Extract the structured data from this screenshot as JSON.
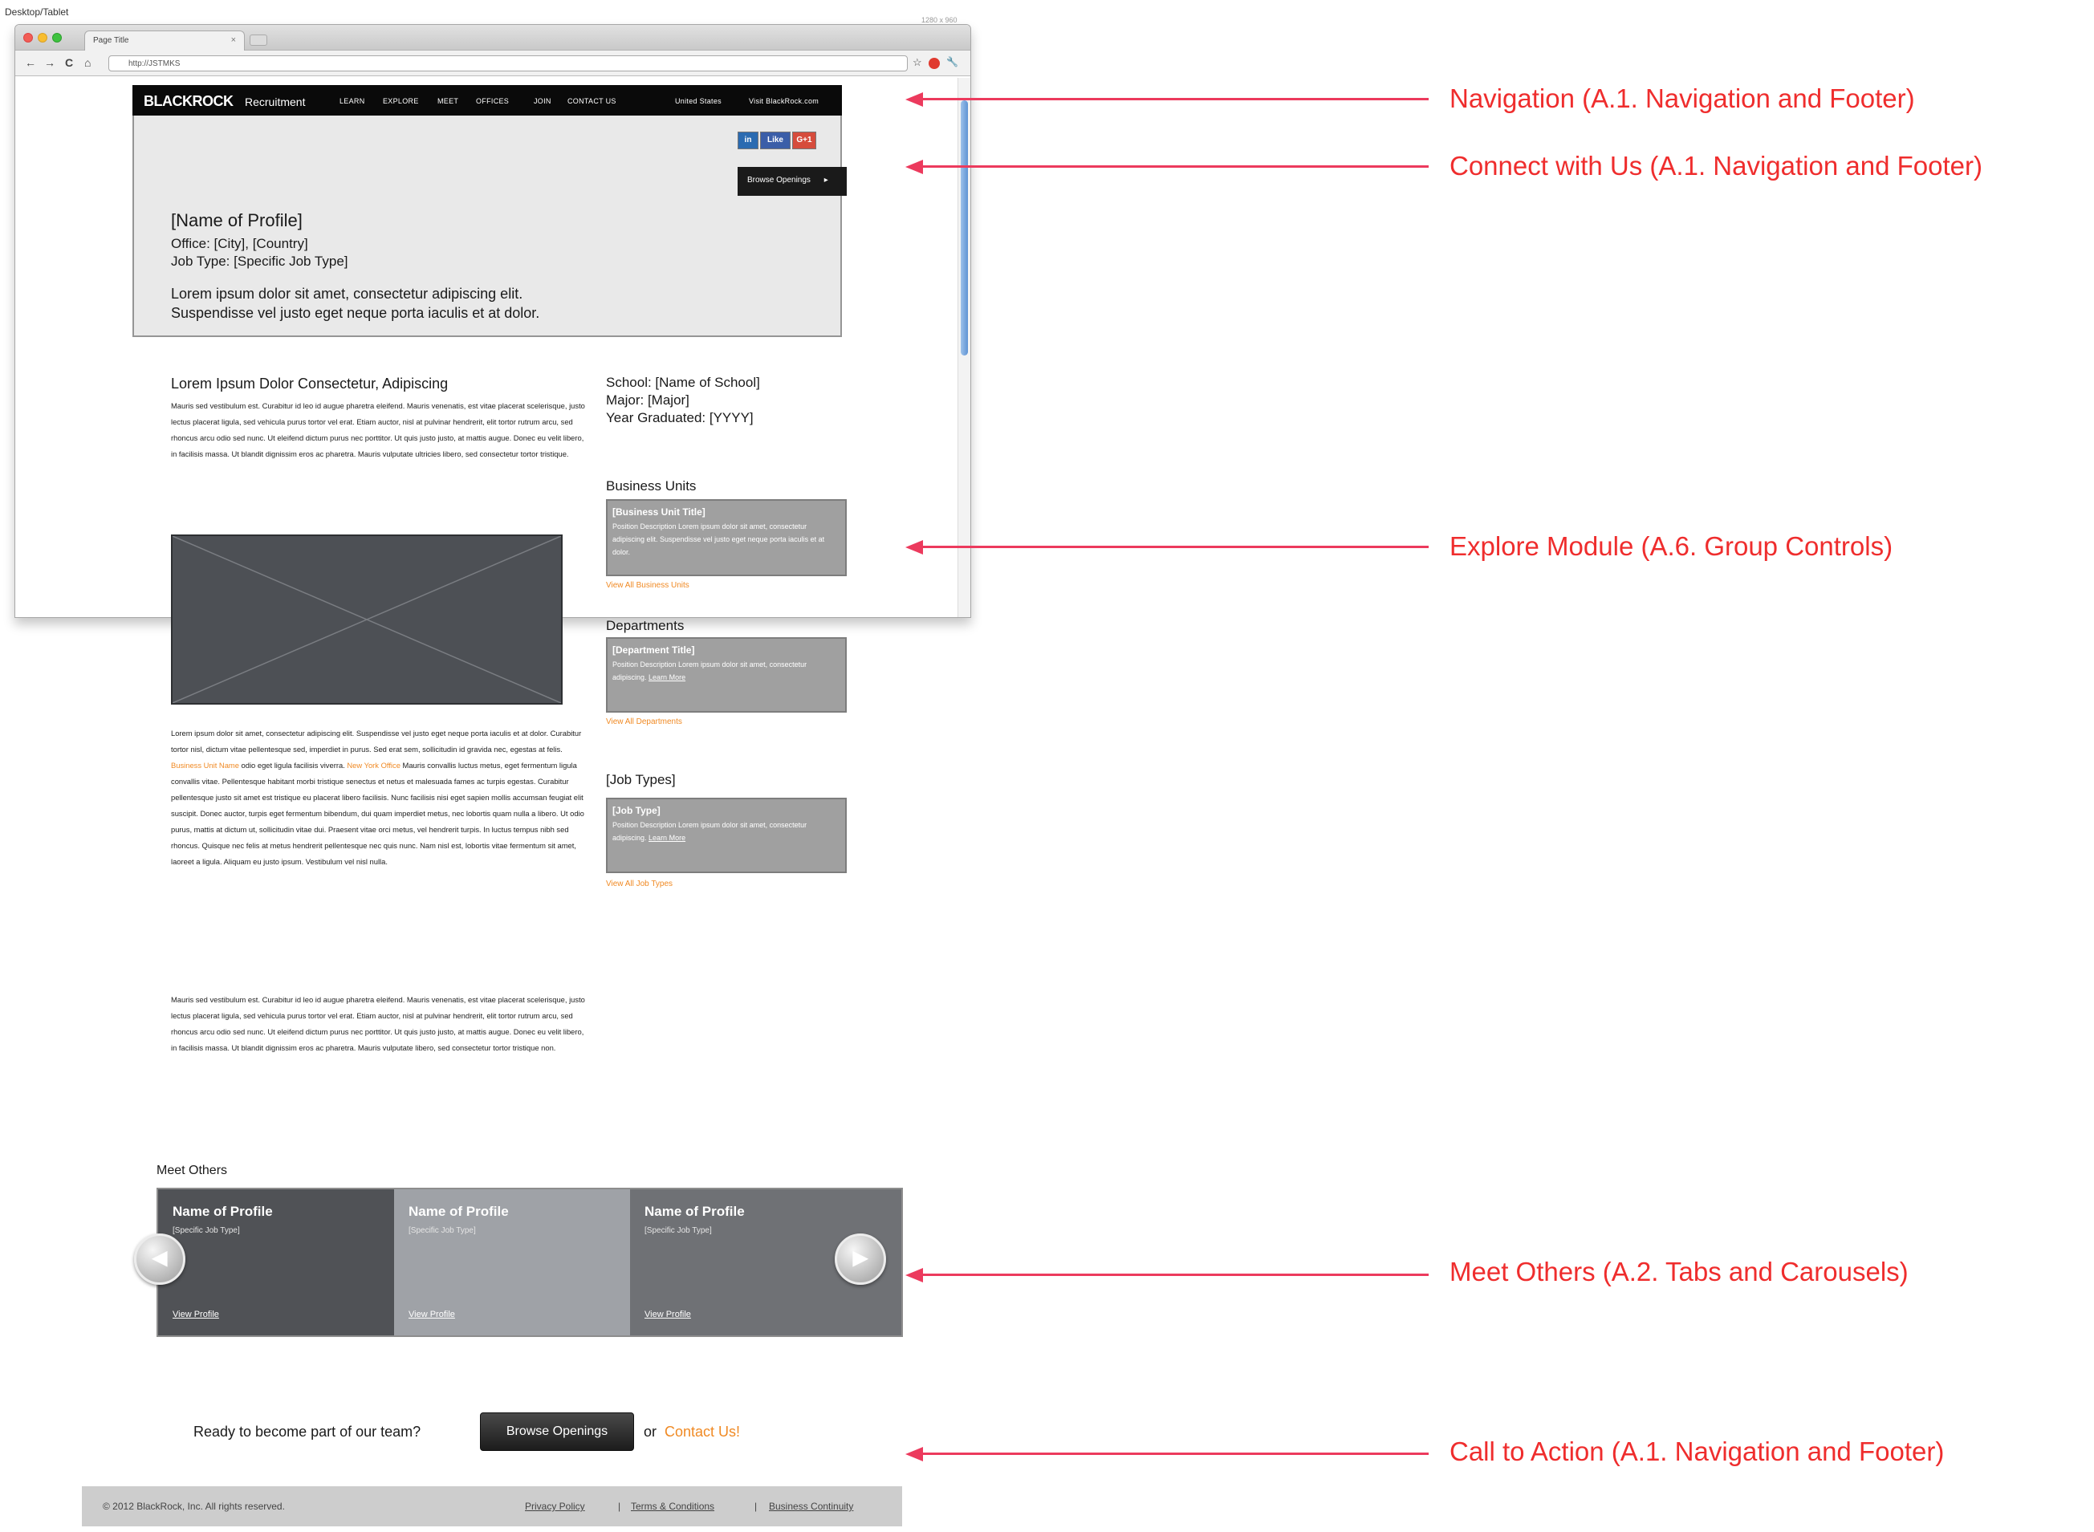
{
  "context": {
    "device_label": "Desktop/Tablet",
    "resolution_label": "1280 x 960"
  },
  "browser": {
    "tab_title": "Page Title",
    "tab_close": "×",
    "url": "http://JSTMKS",
    "nav_icons": {
      "back": "←",
      "forward": "→",
      "reload": "C",
      "home": "⌂"
    },
    "toolbar_icons": {
      "star": "☆",
      "wrench": "🔧"
    }
  },
  "site": {
    "nav": {
      "brand": "BLACKROCK",
      "brand_sub": "Recruitment",
      "items": [
        "LEARN",
        "EXPLORE",
        "MEET",
        "OFFICES",
        "JOIN",
        "CONTACT US"
      ],
      "region": "United States",
      "external_link": "Visit BlackRock.com"
    },
    "hero": {
      "social": [
        "in",
        "Like",
        "G+1"
      ],
      "browse_button": "Browse Openings",
      "browse_arrow": "▸",
      "name": "[Name of Profile]",
      "office": "Office: [City], [Country]",
      "job_type": "Job Type: [Specific Job Type]",
      "lorem_1": "Lorem ipsum dolor sit amet, consectetur adipiscing elit.",
      "lorem_2": "Suspendisse vel justo eget neque porta iaculis et at dolor."
    },
    "main": {
      "title": "Lorem Ipsum Dolor Consectetur, Adipiscing",
      "para1": "Mauris sed vestibulum est. Curabitur id leo id augue pharetra eleifend. Mauris venenatis, est vitae placerat scelerisque, justo lectus placerat ligula, sed vehicula purus tortor vel erat. Etiam auctor, nisl at pulvinar hendrerit, elit tortor rutrum arcu, sed rhoncus arcu odio sed nunc. Ut eleifend dictum purus nec porttitor. Ut quis justo justo, at mattis augue. Donec eu velit libero, in facilisis massa. Ut blandit dignissim eros ac pharetra. Mauris vulputate ultricies libero, sed consectetur tortor tristique.",
      "para2_a": "Lorem ipsum dolor sit amet, consectetur adipiscing elit. Suspendisse vel justo eget neque porta iaculis et at dolor. Curabitur tortor nisl, dictum vitae pellentesque sed, imperdiet in purus. Sed erat sem, sollicitudin id gravida nec, egestas at felis.",
      "para2_link1": "Business Unit Name",
      "para2_b": "odio eget ligula facilisis viverra.",
      "para2_link2": "New York Office",
      "para2_c": "Mauris convallis luctus metus, eget fermentum ligula convallis vitae. Pellentesque habitant morbi tristique senectus et netus et malesuada fames ac turpis egestas. Curabitur pellentesque justo sit amet est tristique eu placerat libero facilisis. Nunc facilisis nisi eget sapien mollis accumsan feugiat elit suscipit. Donec auctor, turpis eget fermentum bibendum, dui quam imperdiet metus, nec lobortis quam nulla a libero. Ut odio purus, mattis at dictum ut, sollicitudin vitae dui. Praesent vitae orci metus, vel hendrerit turpis. In luctus tempus nibh sed rhoncus. Quisque nec felis at metus hendrerit pellentesque nec quis nunc. Nam nisl est, lobortis vitae fermentum sit amet, laoreet a ligula. Aliquam eu justo ipsum. Vestibulum vel nisl nulla.",
      "para3": "Mauris sed vestibulum est. Curabitur id leo id augue pharetra eleifend. Mauris venenatis, est vitae placerat scelerisque, justo lectus placerat ligula, sed vehicula purus tortor vel erat. Etiam auctor, nisl at pulvinar hendrerit, elit tortor rutrum arcu, sed rhoncus arcu odio sed nunc. Ut eleifend dictum purus nec porttitor. Ut quis justo justo, at mattis augue. Donec eu velit libero, in facilisis massa. Ut blandit dignissim eros ac pharetra. Mauris vulputate libero, sed consectetur tortor tristique non."
    },
    "sidebar": {
      "school": "School: [Name of School]",
      "major": "Major: [Major]",
      "year": "Year Graduated: [YYYY]",
      "business_units": {
        "heading": "Business Units",
        "box_title": "[Business Unit Title]",
        "box_text": "Position Description Lorem ipsum dolor sit amet, consectetur adipiscing elit. Suspendisse vel justo eget neque porta iaculis et at dolor.",
        "link": "View All Business Units"
      },
      "departments": {
        "heading": "Departments",
        "box_title": "[Department Title]",
        "box_text": "Position Description Lorem ipsum dolor sit amet, consectetur adipiscing.",
        "learn_more": "Learn More",
        "link": "View All Departments"
      },
      "job_types": {
        "heading": "[Job Types]",
        "box_title": "[Job Type]",
        "box_text": "Position Description Lorem ipsum dolor sit amet, consectetur adipiscing.",
        "learn_more": "Learn More",
        "link": "View All Job Types"
      }
    },
    "meet_others": {
      "title": "Meet Others",
      "prev_arrow": "◀",
      "next_arrow": "▶",
      "cards": [
        {
          "name": "Name of Profile",
          "job": "[Specific Job Type]",
          "link": "View Profile",
          "color": "#505256"
        },
        {
          "name": "Name of Profile",
          "job": "[Specific Job Type]",
          "link": "View Profile",
          "color": "#9fa2a7"
        },
        {
          "name": "Name of Profile",
          "job": "[Specific Job Type]",
          "link": "View Profile",
          "color": "#6f7175"
        }
      ]
    },
    "cta": {
      "prompt": "Ready to become part of our team?",
      "button": "Browse Openings",
      "or": "or",
      "contact": "Contact Us!"
    },
    "footer": {
      "copyright": "© 2012 BlackRock, Inc. All rights reserved.",
      "links": [
        "Privacy Policy",
        "Terms & Conditions",
        "Business Continuity"
      ],
      "separator": "|"
    }
  },
  "annotations": [
    "Navigation (A.1. Navigation and Footer)",
    "Connect with Us (A.1. Navigation and Footer)",
    "Explore Module (A.6. Group Controls)",
    "Meet Others (A.2. Tabs and Carousels)",
    "Call to Action (A.1. Navigation and Footer)"
  ],
  "colors": {
    "annotation": "#ef2d2d",
    "arrow": "#ec3a5d",
    "accent_orange": "#f08a24",
    "nav_bg": "#0a0a0a"
  }
}
